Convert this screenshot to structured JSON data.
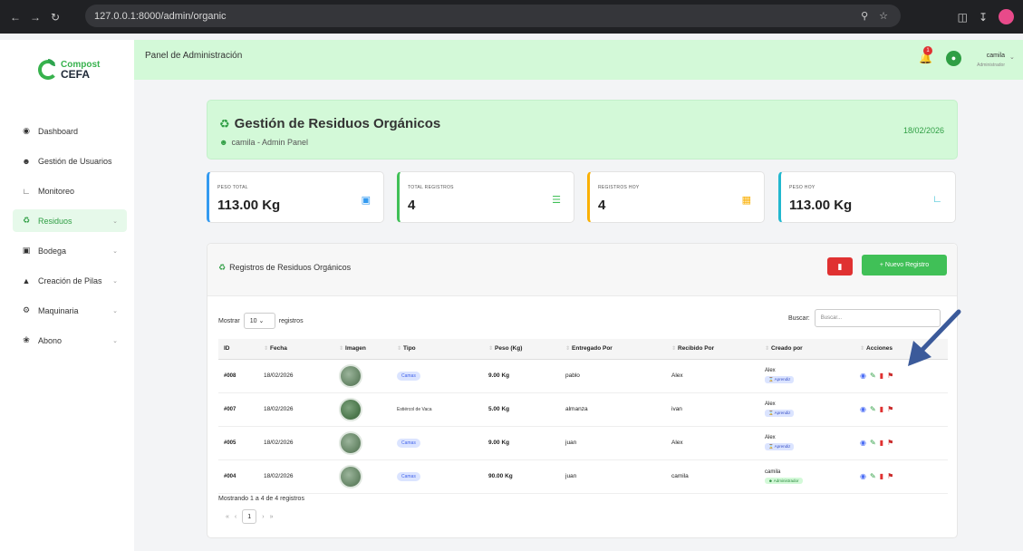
{
  "browser": {
    "url": "127.0.0.1:8000/admin/organic"
  },
  "brand": {
    "line1": "Compost",
    "line2": "CEFA"
  },
  "sidebar": {
    "items": [
      {
        "label": "Dashboard",
        "icon": "dashboard-icon"
      },
      {
        "label": "Gestión de Usuarios",
        "icon": "users-icon"
      },
      {
        "label": "Monitoreo",
        "icon": "chart-icon"
      },
      {
        "label": "Residuos",
        "icon": "recycle-icon"
      },
      {
        "label": "Bodega",
        "icon": "warehouse-icon"
      },
      {
        "label": "Creación de Pilas",
        "icon": "mountain-icon"
      },
      {
        "label": "Maquinaria",
        "icon": "gears-icon"
      },
      {
        "label": "Abono",
        "icon": "sprout-icon"
      }
    ]
  },
  "header": {
    "title": "Panel de Administración",
    "notif_count": "1",
    "user_name": "camila",
    "user_role": "Administrador"
  },
  "page": {
    "title": "Gestión de Residuos Orgánicos",
    "subtitle": "camila - Admin Panel",
    "date": "18/02/2026"
  },
  "stats": [
    {
      "label": "PESO TOTAL",
      "value": "113.00 Kg",
      "color": "#339af0"
    },
    {
      "label": "TOTAL REGISTROS",
      "value": "4",
      "color": "#40c057"
    },
    {
      "label": "REGISTROS HOY",
      "value": "4",
      "color": "#fab005"
    },
    {
      "label": "PESO HOY",
      "value": "113.00 Kg",
      "color": "#22b8cf"
    }
  ],
  "table_card": {
    "title": "Registros de Residuos Orgánicos",
    "new_label": "+ Nuevo Registro",
    "show_label": "Mostrar",
    "show_value": "10",
    "records_label": "registros",
    "search_label": "Buscar:",
    "search_placeholder": "Buscar...",
    "columns": [
      "ID",
      "Fecha",
      "Imagen",
      "Tipo",
      "Peso (Kg)",
      "Entregado Por",
      "Recibido Por",
      "Creado por",
      "Acciones"
    ],
    "rows": [
      {
        "id": "#008",
        "fecha": "18/02/2026",
        "tipo": "Camas",
        "peso": "9.00 Kg",
        "entregado": "pablo",
        "recibido": "Alex",
        "creado": "Alex",
        "rol": "Aprendiz"
      },
      {
        "id": "#007",
        "fecha": "18/02/2026",
        "tipo": "Estiércol de Vaca",
        "peso": "5.00 Kg",
        "entregado": "almanza",
        "recibido": "ivan",
        "creado": "Alex",
        "rol": "Aprendiz"
      },
      {
        "id": "#005",
        "fecha": "18/02/2026",
        "tipo": "Camas",
        "peso": "9.00 Kg",
        "entregado": "juan",
        "recibido": "Alex",
        "creado": "Alex",
        "rol": "Aprendiz"
      },
      {
        "id": "#004",
        "fecha": "18/02/2026",
        "tipo": "Camas",
        "peso": "90.00 Kg",
        "entregado": "juan",
        "recibido": "camila",
        "creado": "camila",
        "rol": "Administrador"
      }
    ],
    "info": "Mostrando 1 a 4 de 4 registros",
    "page": "1"
  }
}
